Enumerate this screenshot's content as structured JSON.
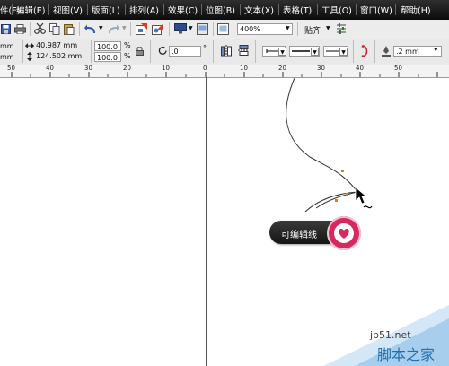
{
  "menu": {
    "items": [
      "件(F)",
      "编辑(E)",
      "视图(V)",
      "版面(L)",
      "排列(A)",
      "效果(C)",
      "位图(B)",
      "文本(X)",
      "表格(T)",
      "工具(O)",
      "窗口(W)",
      "帮助(H)"
    ]
  },
  "toolbar1": {
    "zoom_value": "400%",
    "snap_label": "贴齐"
  },
  "toolbar2": {
    "x_value": "mm",
    "y_value": "mm",
    "width_value": "40.987 mm",
    "height_value": "124.502 mm",
    "scale_x": "100.0",
    "scale_y": "100.0",
    "percent_symbol": "%",
    "rotation_value": ".0",
    "degree_symbol": "°",
    "outline_width": ".2 mm"
  },
  "ruler": {
    "labels": [
      "50",
      "40",
      "30",
      "20",
      "10",
      "0",
      "10",
      "20",
      "30",
      "40",
      "50"
    ]
  },
  "tooltip": {
    "text": "可编辑线"
  },
  "watermark": {
    "site": "jb51.net",
    "name": "脚本之家"
  },
  "colors": {
    "menubar": "#1a1a1a",
    "accent_pink": "#d7285f",
    "watermark_blue": "#1f6fb2"
  }
}
